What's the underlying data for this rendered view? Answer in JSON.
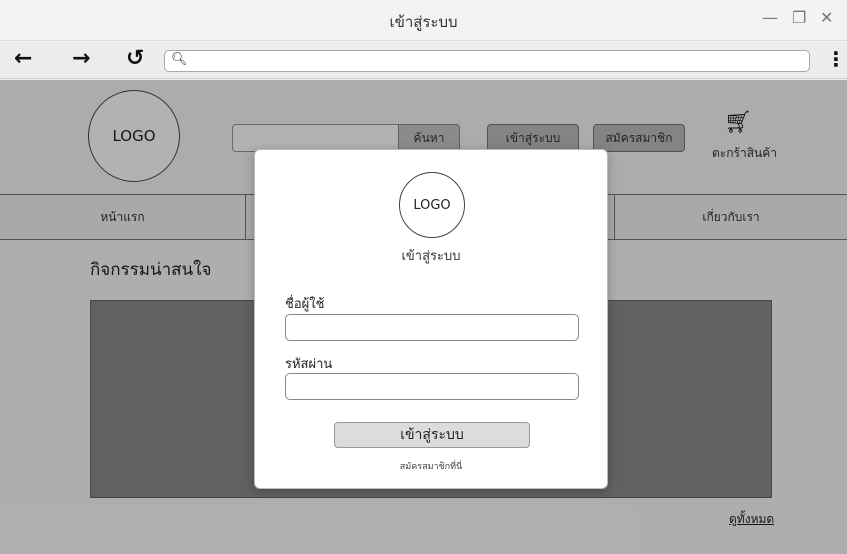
{
  "window": {
    "title": "เข้าสู่ระบบ",
    "minimize": "—",
    "restore": "❐",
    "close": "✕"
  },
  "browser": {
    "back": "←",
    "forward": "→",
    "reload": "↺",
    "url_value": "",
    "menu": "⋮",
    "search_icon": "magnifier-icon"
  },
  "header": {
    "logo": "LOGO",
    "search_placeholder": "",
    "search_button": "ค้นหา",
    "login_button": "เข้าสู่ระบบ",
    "register_button": "สมัครสมาชิก",
    "cart_label": "ตะกร้าสินค้า"
  },
  "menu": {
    "items": [
      {
        "label": "หน้าแรก"
      },
      {
        "label": ""
      },
      {
        "label": ""
      },
      {
        "label": "เกี่ยวกับเรา"
      }
    ]
  },
  "main": {
    "section_title": "กิจกรรมน่าสนใจ",
    "see_all": "ดูทั้งหมด"
  },
  "modal": {
    "logo": "LOGO",
    "title": "เข้าสู่ระบบ",
    "username_label": "ชื่อผู้ใช้",
    "username_value": "",
    "password_label": "รหัสผ่าน",
    "password_value": "",
    "submit": "เข้าสู่ระบบ",
    "register_link": "สมัครสมาชิกที่นี่"
  },
  "colors": {
    "overlay": "#000000",
    "banner": "#8c8c8c",
    "modal_bg": "#ffffff",
    "submit_bg": "#dcdcdc"
  }
}
